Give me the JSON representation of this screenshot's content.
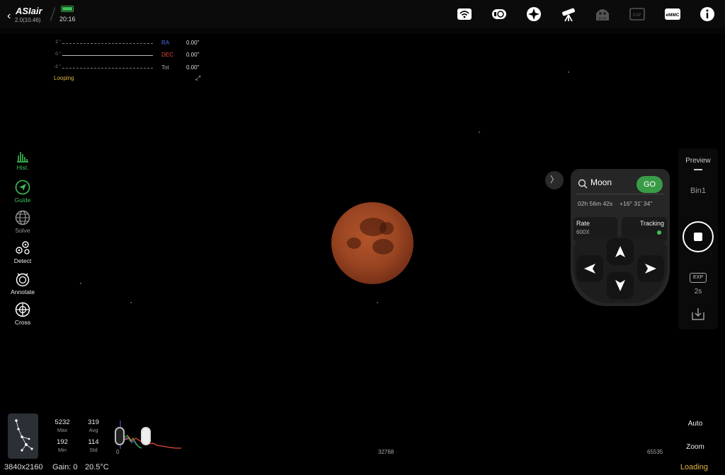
{
  "app": {
    "name": "ASIair",
    "version": "2.0(10.46)",
    "time": "20:16",
    "battery_level": 1.0
  },
  "top_icons": [
    "wifi-icon",
    "power-icon",
    "focuser-icon",
    "telescope-icon",
    "efw-icon",
    "eaf-icon",
    "emmc-icon",
    "info-icon"
  ],
  "top_icon_labels": {
    "efw": "EFW",
    "eaf": "EAF",
    "emmc": "eMMC"
  },
  "guide_graph": {
    "ticks": [
      "2 \"",
      "0 \"",
      "-2 \""
    ],
    "ra_label": "RA",
    "ra_value": "0.00\"",
    "dec_label": "DEC",
    "dec_value": "0.00\"",
    "tot_label": "Tot",
    "tot_value": "0.00\"",
    "status": "Looping"
  },
  "tools": [
    {
      "label": "Hist.",
      "active": true
    },
    {
      "label": "Guide",
      "active": true
    },
    {
      "label": "Solve",
      "active": false
    },
    {
      "label": "Detect",
      "active": false
    },
    {
      "label": "Annotate",
      "active": false
    },
    {
      "label": "Cross",
      "active": false
    }
  ],
  "goto": {
    "object": "Moon",
    "go_label": "GO",
    "ra": "02h 56m 42s",
    "dec": "+16° 31' 34\"",
    "rate_label": "Rate",
    "rate_value": "600X",
    "tracking_label": "Tracking",
    "tracking_on": true,
    "collapse": "〉"
  },
  "right_rail": {
    "preview": "Preview",
    "bin": "Bin1",
    "exp_label": "EXP",
    "exp_value": "2s"
  },
  "histogram": {
    "max": "5232",
    "max_label": "Max",
    "avg": "319",
    "avg_label": "Avg",
    "min": "192",
    "min_label": "Min",
    "std": "114",
    "std_label": "Std",
    "axis_start": "0",
    "axis_mid": "32768",
    "axis_end": "65535",
    "auto_label": "Auto",
    "zoom_label": "Zoom"
  },
  "status": {
    "resolution": "3840x2160",
    "gain": "Gain: 0",
    "temp": "20.5°C",
    "loading": "Loading"
  },
  "colors": {
    "accent_green": "#3cc157",
    "go_green": "#3a9b47",
    "status_yellow": "#e0b544",
    "ra_blue": "#4a6fe3",
    "dec_red": "#e04a3a"
  }
}
